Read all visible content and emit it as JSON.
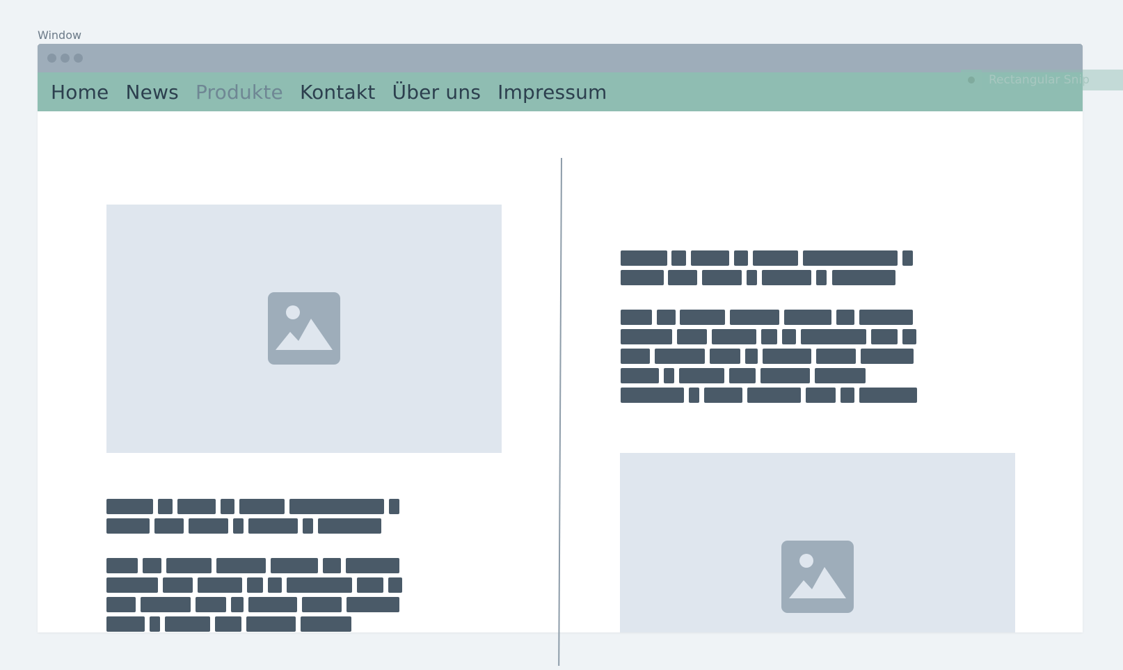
{
  "window": {
    "label": "Window"
  },
  "nav": {
    "items": [
      {
        "label": "Home",
        "active": false
      },
      {
        "label": "News",
        "active": false
      },
      {
        "label": "Produkte",
        "active": true
      },
      {
        "label": "Kontakt",
        "active": false
      },
      {
        "label": "Über uns",
        "active": false
      },
      {
        "label": "Impressum",
        "active": false
      }
    ]
  },
  "overlay": {
    "label": "Rectangular Snip"
  },
  "content": {
    "image_placeholder_icon": "image-icon",
    "colors": {
      "background": "#eff3f6",
      "titlebar": "#9eadba",
      "navbar": "#8fbdb2",
      "nav_text": "#2c3f4e",
      "nav_active_text": "#6f8794",
      "placeholder": "#dfe6ee",
      "text_block": "#4a5a68"
    }
  }
}
